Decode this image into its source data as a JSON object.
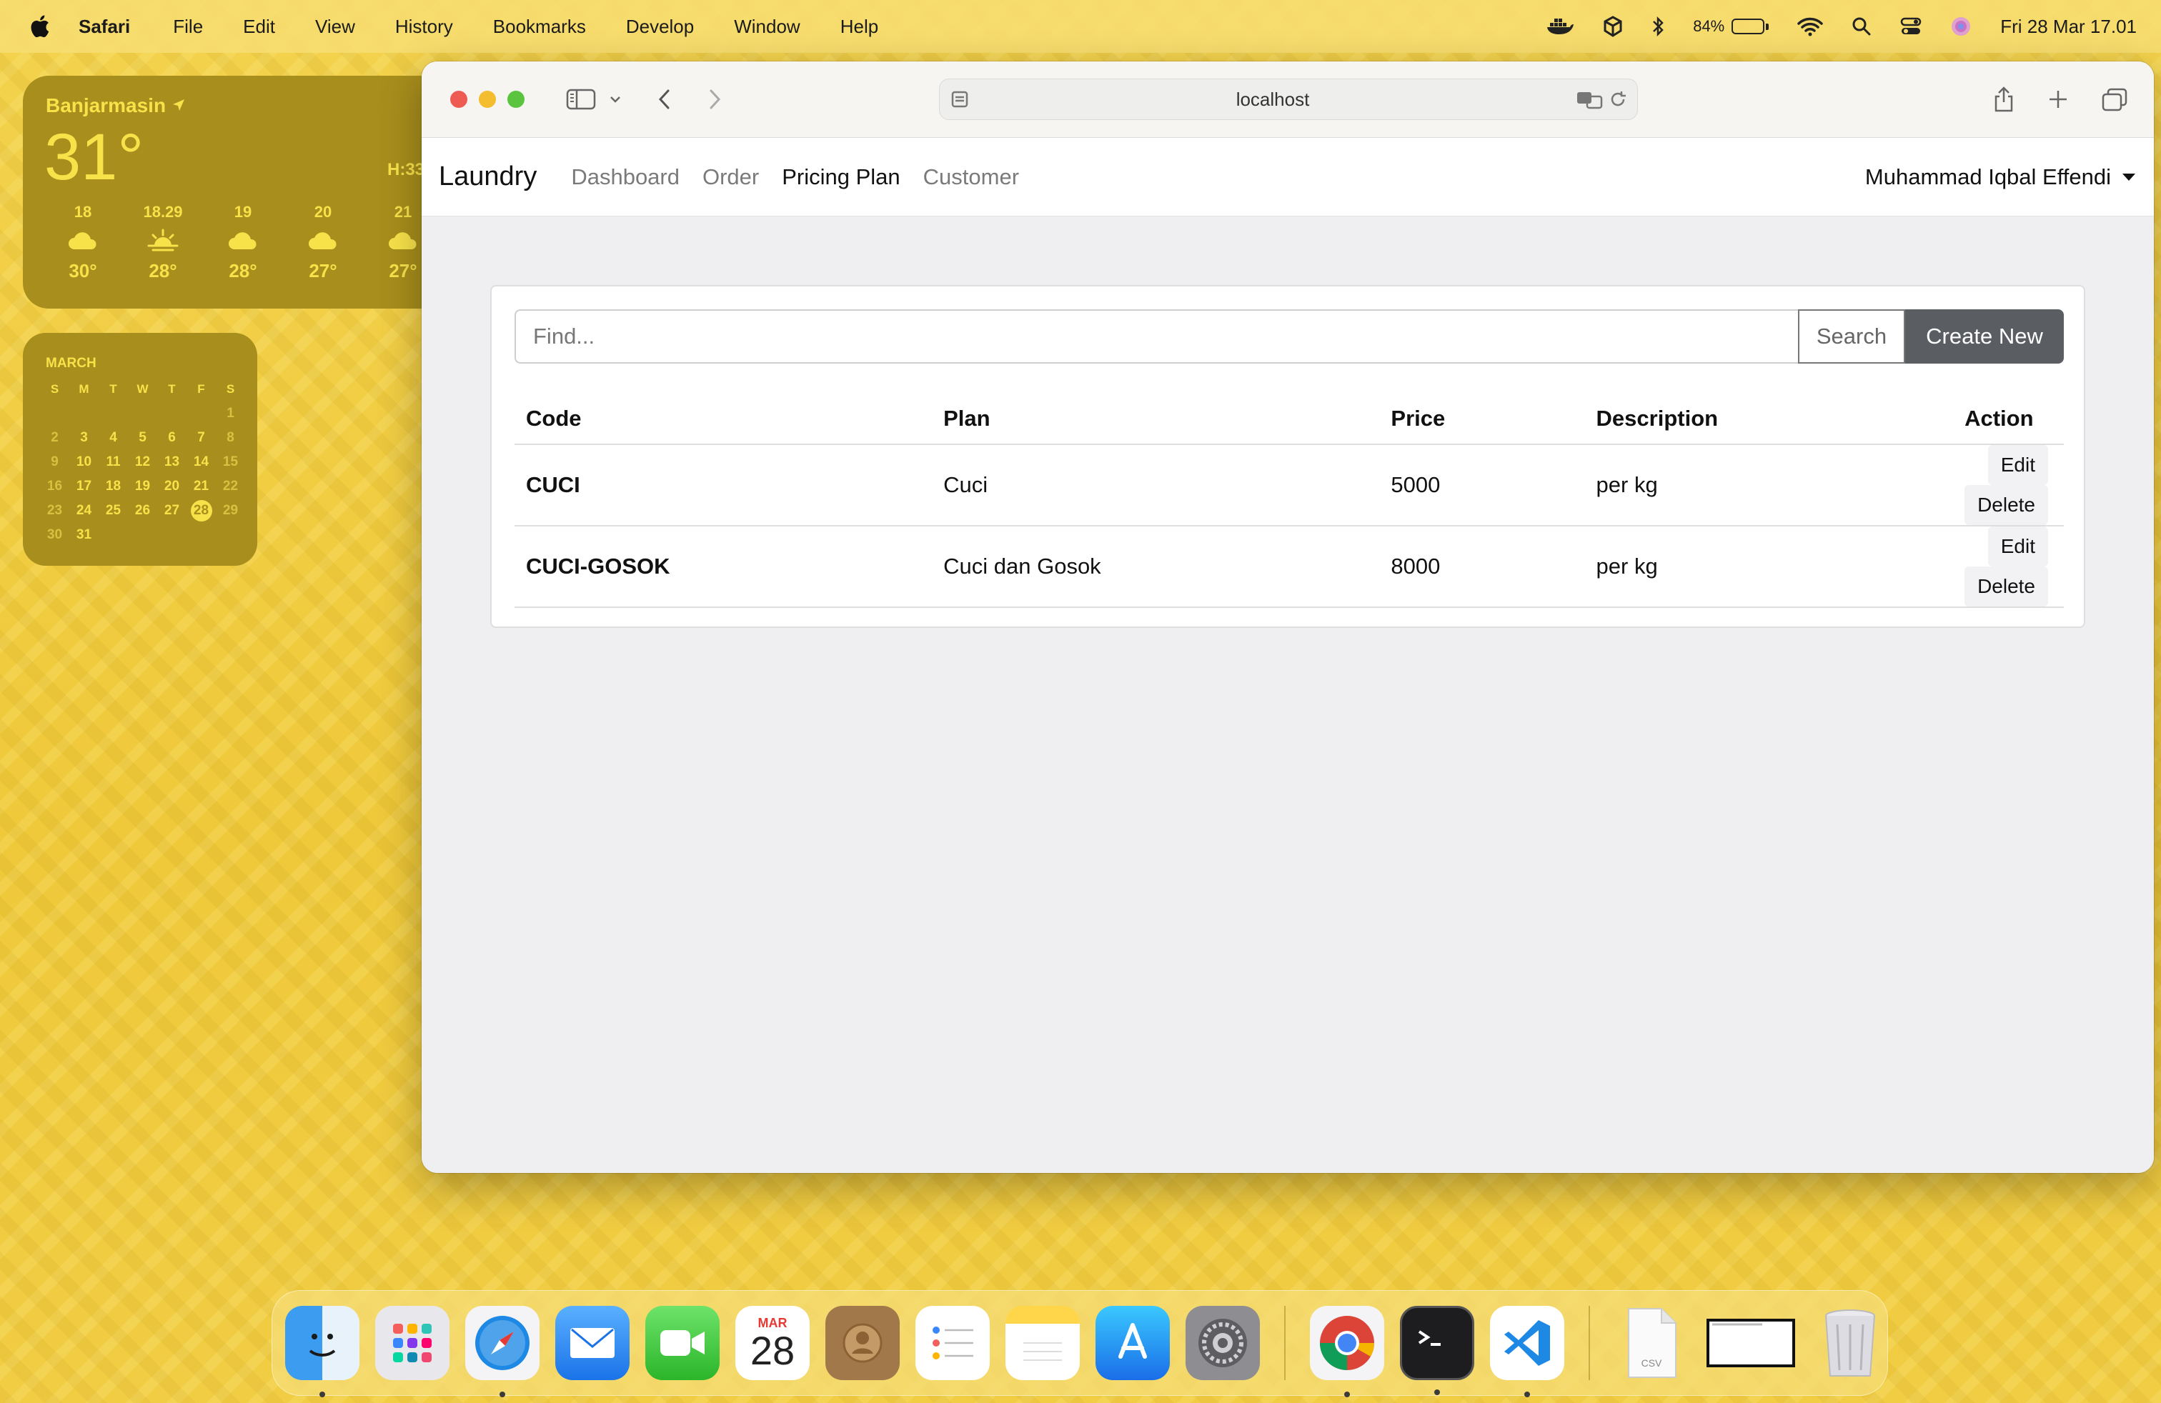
{
  "menubar": {
    "app": "Safari",
    "items": [
      "File",
      "Edit",
      "View",
      "History",
      "Bookmarks",
      "Develop",
      "Window",
      "Help"
    ],
    "battery_percent": "84%",
    "datetime": "Fri 28 Mar  17.01"
  },
  "weather": {
    "city": "Banjarmasin",
    "temp": "31°",
    "high": "H:33",
    "forecast": [
      {
        "time": "18",
        "icon": "cloud-icon",
        "temp": "30°"
      },
      {
        "time": "18.29",
        "icon": "sunset-icon",
        "temp": "28°"
      },
      {
        "time": "19",
        "icon": "cloud-icon",
        "temp": "28°"
      },
      {
        "time": "20",
        "icon": "cloud-icon",
        "temp": "27°"
      },
      {
        "time": "21",
        "icon": "cloud-icon",
        "temp": "27°"
      }
    ]
  },
  "calendar": {
    "month": "MARCH",
    "weekdays": [
      "S",
      "M",
      "T",
      "W",
      "T",
      "F",
      "S"
    ],
    "today": "28"
  },
  "browser": {
    "url": "localhost"
  },
  "nav": {
    "brand": "Laundry",
    "links": [
      "Dashboard",
      "Order",
      "Pricing Plan",
      "Customer"
    ],
    "active": "Pricing Plan",
    "user": "Muhammad Iqbal Effendi"
  },
  "search": {
    "placeholder": "Find...",
    "value": "",
    "search_label": "Search",
    "create_label": "Create New"
  },
  "table": {
    "headers": [
      "Code",
      "Plan",
      "Price",
      "Description",
      "Action"
    ],
    "rows": [
      {
        "code": "CUCI",
        "plan": "Cuci",
        "price": "5000",
        "description": "per kg",
        "edit": "Edit",
        "delete": "Delete"
      },
      {
        "code": "CUCI-GOSOK",
        "plan": "Cuci dan Gosok",
        "price": "8000",
        "description": "per kg",
        "edit": "Edit",
        "delete": "Delete"
      }
    ]
  },
  "dock": {
    "apps": [
      "Finder",
      "Launchpad",
      "Safari",
      "Mail",
      "FaceTime",
      "Calendar",
      "Contacts",
      "Reminders",
      "Notes",
      "App Store",
      "System Settings",
      "Google Chrome",
      "Terminal",
      "Visual Studio Code",
      "CSV file",
      "Window",
      "Trash"
    ],
    "calendar_month": "MAR",
    "calendar_day": "28",
    "csv_label": "CSV"
  },
  "colors": {
    "wallpaper": "#f2cf45",
    "widget": "#a88e1c",
    "widget_text": "#f8e24a",
    "primary_button": "#5a5d61"
  }
}
